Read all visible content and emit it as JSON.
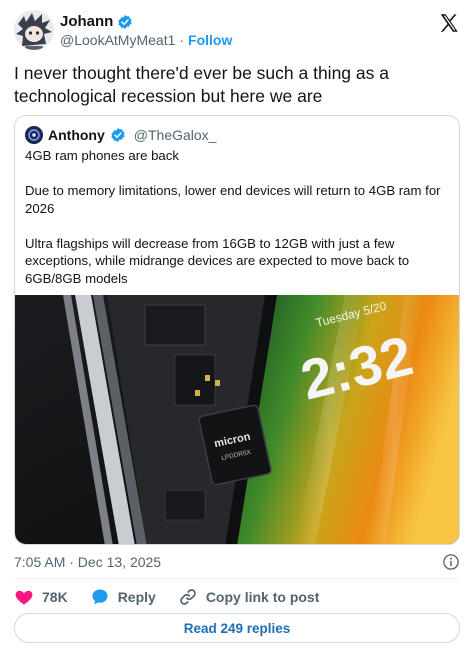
{
  "author": {
    "name": "Johann",
    "handle": "@LookAtMyMeat1",
    "separator": "·",
    "follow_label": "Follow"
  },
  "tweet": {
    "text": "I never thought there'd ever be such a thing as a technological recession but here we are",
    "timestamp": "7:05 AM · Dec 13, 2025"
  },
  "quoted_tweet": {
    "name": "Anthony",
    "handle": "@TheGalox_",
    "paragraphs": [
      "4GB ram phones are back",
      "Due to memory limitations, lower end devices will return to 4GB ram for 2026",
      "Ultra flagships will decrease from 16GB to 12GB with just a few exceptions, while midrange devices are expected to move back to 6GB/8GB models"
    ],
    "image": {
      "chip_brand": "micron",
      "chip_model": "LPDDR5X",
      "lockscreen_date": "Tuesday 5/20",
      "lockscreen_time": "2:32"
    }
  },
  "actions": {
    "like_count": "78K",
    "reply_label": "Reply",
    "copy_link_label": "Copy link to post"
  },
  "read_replies_label": "Read 249 replies",
  "colors": {
    "accent": "#1d9bf0",
    "like": "#f91880",
    "text": "#0f1419",
    "muted": "#536471",
    "border": "#cfd9de"
  },
  "icons": {
    "verified": "verified-badge-icon",
    "x_logo": "x-logo-icon",
    "info": "info-icon",
    "like": "heart-icon",
    "reply": "chat-bubble-icon",
    "copy_link": "link-icon"
  }
}
